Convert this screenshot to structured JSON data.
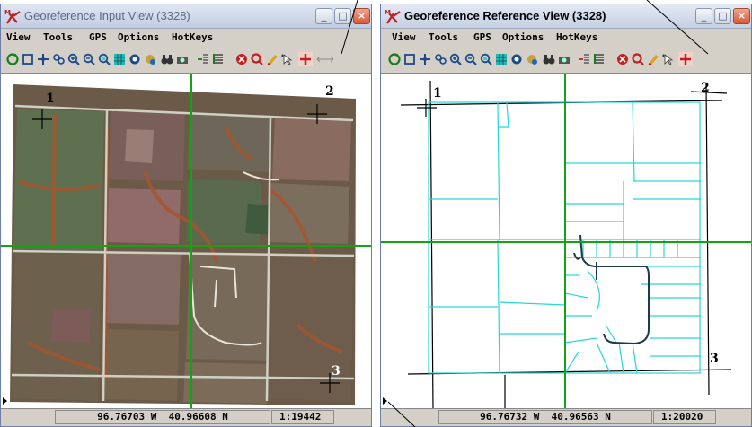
{
  "input_window": {
    "title": "Georeference Input View (3328)",
    "menu": [
      "View",
      "Tools",
      "GPS",
      "Options",
      "HotKeys"
    ],
    "status": {
      "longitude": "96.76703 W",
      "latitude": "40.96608 N",
      "scale": "1:19442"
    },
    "gcp_labels": [
      "1",
      "2",
      "3"
    ]
  },
  "reference_window": {
    "title": "Georeference Reference View (3328)",
    "menu": [
      "View",
      "Tools",
      "GPS",
      "Options",
      "HotKeys"
    ],
    "status": {
      "longitude": "96.76732 W",
      "latitude": "40.96563 N",
      "scale": "1:20020"
    },
    "gcp_labels": [
      "1",
      "2",
      "3"
    ]
  },
  "window_buttons": {
    "minimize": "_",
    "maximize": "□",
    "close": "×"
  },
  "colors": {
    "crosshair": "#13a313",
    "parcel_lines": "#27d6d6",
    "roads": "#1f3a4a",
    "aerial_base": "#6a5a47",
    "title_text": "#5a6a88"
  },
  "icons": [
    "redraw-icon",
    "select-icon",
    "pan-icon",
    "zoom-fit-icon",
    "zoom-in-icon",
    "zoom-out-icon",
    "zoom-box-icon",
    "layers-icon",
    "gps-icon",
    "hand-icon",
    "binoculars-icon",
    "camera-icon",
    "add-point-icon",
    "list-icon",
    "stop-icon",
    "zoom-red-icon",
    "edit-icon",
    "cursor-icon",
    "crosshair-icon"
  ]
}
